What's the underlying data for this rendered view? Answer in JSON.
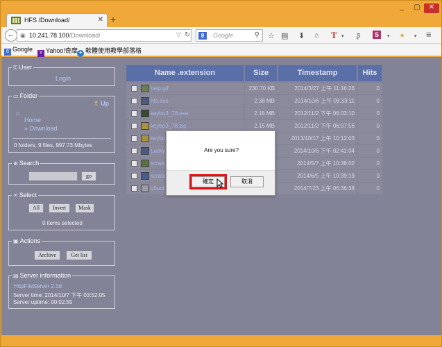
{
  "browser": {
    "tab_title": "HFS /Download/",
    "url_host": "10.241.78.100",
    "url_path": "/Download/",
    "search_placeholder": "Google",
    "search_engine_letter": "8"
  },
  "bookmarks": [
    {
      "label": "Google",
      "icon": "google-icon",
      "color": "#3b6ed4"
    },
    {
      "label": "Yahoo!奇摩",
      "icon": "yahoo-icon",
      "color": "#6b1ea0"
    },
    {
      "label": "軟體使用教學部落格",
      "icon": "blog-icon",
      "color": "#2a7fd0"
    }
  ],
  "sidebar": {
    "user": {
      "legend": "User",
      "login_link": "Login"
    },
    "folder": {
      "legend": "Folder",
      "up_label": "Up",
      "home_link": "Home",
      "current_link": "» Download",
      "summary": "0 folders, 9 files, 997.73 Mbytes"
    },
    "search": {
      "legend": "Search",
      "go_label": "go"
    },
    "select": {
      "legend": "Select",
      "all_label": "All",
      "invert_label": "Invert",
      "mask_label": "Mask",
      "count_text": "0 items selected"
    },
    "actions": {
      "legend": "Actions",
      "archive_label": "Archive",
      "getlist_label": "Get list"
    },
    "server": {
      "legend": "Server information",
      "software_link": "HttpFileServer 2.3d",
      "server_time": "Server time: 2014/10/7 下午 03:52:05",
      "server_uptime": "Server uptime: 00:02:55"
    }
  },
  "table": {
    "headers": {
      "name": "Name .extension",
      "size": "Size",
      "timestamp": "Timestamp",
      "hits": "Hits"
    },
    "rows": [
      {
        "name": "help.gif",
        "size": "230.70 KB",
        "timestamp": "2014/3/27 上午 11:16:26",
        "hits": "0"
      },
      {
        "name": "hfs.exe",
        "size": "2.38 MB",
        "timestamp": "2014/10/6 上午 09:33:11",
        "hits": "0"
      },
      {
        "name": "keybo3_78.exe",
        "size": "2.16 MB",
        "timestamp": "2012/11/2 下午 06:03:10",
        "hits": "0"
      },
      {
        "name": "keybo3_78.zip",
        "size": "2.15 MB",
        "timestamp": "2012/11/2 下午 06:07:56",
        "hits": "0"
      },
      {
        "name": "keybo",
        "size": "",
        "timestamp": "2013/10/17 上午 10:12:03",
        "hits": "0"
      },
      {
        "name": "Lucky",
        "size": "",
        "timestamp": "2014/10/6 下午 02:41:04",
        "hits": "0"
      },
      {
        "name": "scratc",
        "size": "",
        "timestamp": "2014/5/7 上午 10:38:02",
        "hits": "0"
      },
      {
        "name": "scratc",
        "size": "",
        "timestamp": "2014/6/5 上午 10:39:19",
        "hits": "0"
      },
      {
        "name": "ubunt",
        "size": "",
        "timestamp": "2014/7/23 上午 06:36:38",
        "hits": "0"
      }
    ]
  },
  "dialog": {
    "message": "Are you sure?",
    "ok_label": "確定",
    "cancel_label": "取消",
    "highlight_color": "#e21010"
  }
}
